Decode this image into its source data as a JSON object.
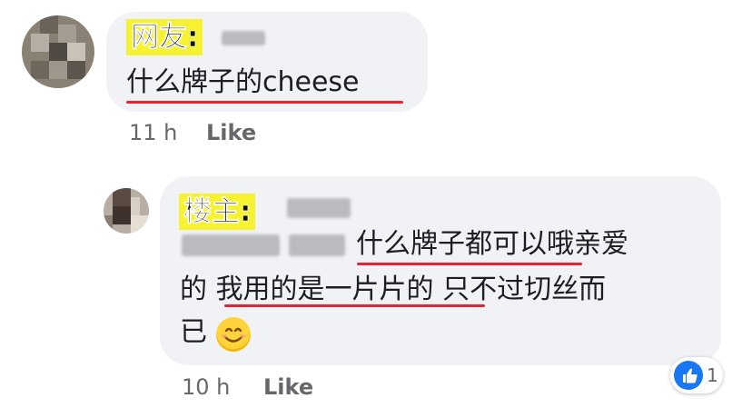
{
  "comment1": {
    "tag": "网友:",
    "text": "什么牌子的cheese",
    "time": "11 h",
    "like_label": "Like"
  },
  "comment2": {
    "tag": "楼主:",
    "text_line1": "什么牌子都可以哦亲爱",
    "text_line2": "的 我用的是一片片的 只不过切丝而",
    "text_line3": "已",
    "emoji": "smiling-face-emoji",
    "time": "10 h",
    "like_label": "Like",
    "reaction_count": "1",
    "reaction": "like-thumb-icon"
  },
  "colors": {
    "bubble": "#f0f2f5",
    "tag": "#f7f230",
    "underline": "#e8232f",
    "meta": "#65676b",
    "reaction": "#1877f2"
  }
}
